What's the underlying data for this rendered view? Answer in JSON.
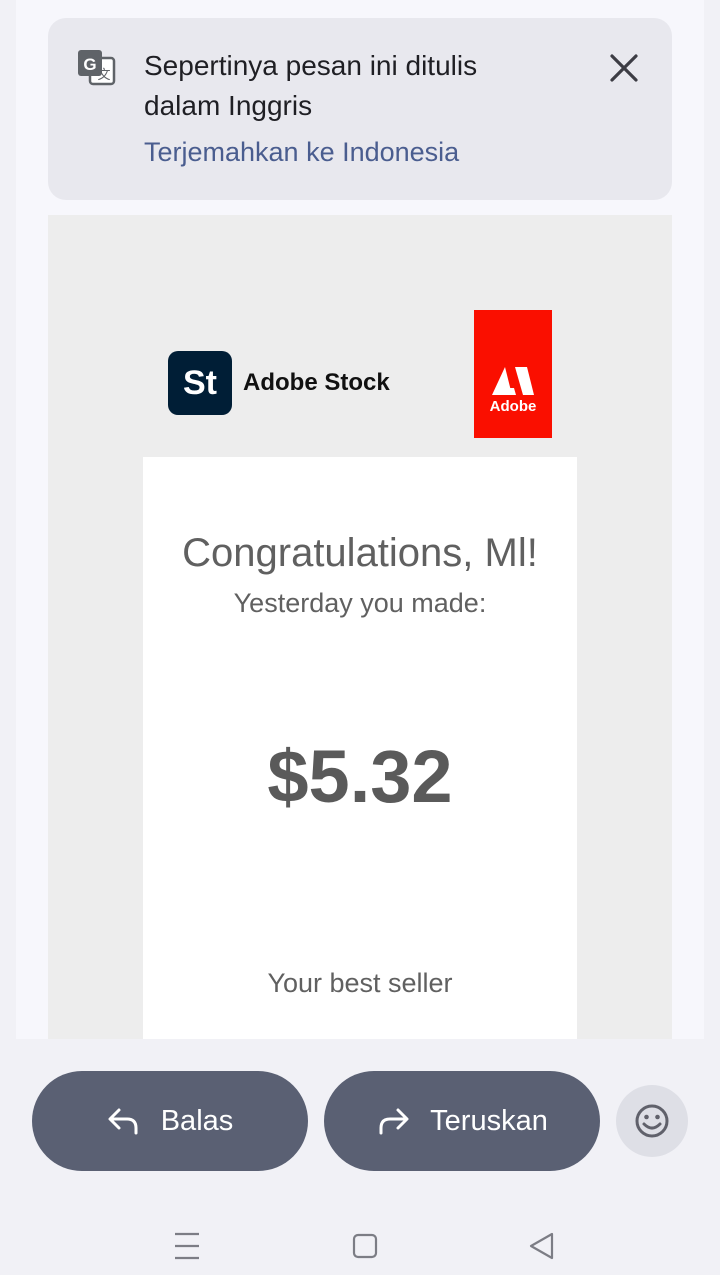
{
  "translate_banner": {
    "message": "Sepertinya pesan ini ditulis dalam Inggris",
    "action": "Terjemahkan ke Indonesia",
    "icon": "google-translate-icon"
  },
  "email": {
    "stock_logo_text": "St",
    "stock_brand": "Adobe Stock",
    "adobe_label": "Adobe",
    "title": "Congratulations, Ml!",
    "subtitle": "Yesterday you made:",
    "amount": "$5.32",
    "best_seller": "Your best seller"
  },
  "actions": {
    "reply_label": "Balas",
    "forward_label": "Teruskan"
  },
  "colors": {
    "button": "#5a6073",
    "link": "#4a5d8f",
    "adobe_red": "#fa0f00",
    "stock_dark": "#001e36"
  }
}
